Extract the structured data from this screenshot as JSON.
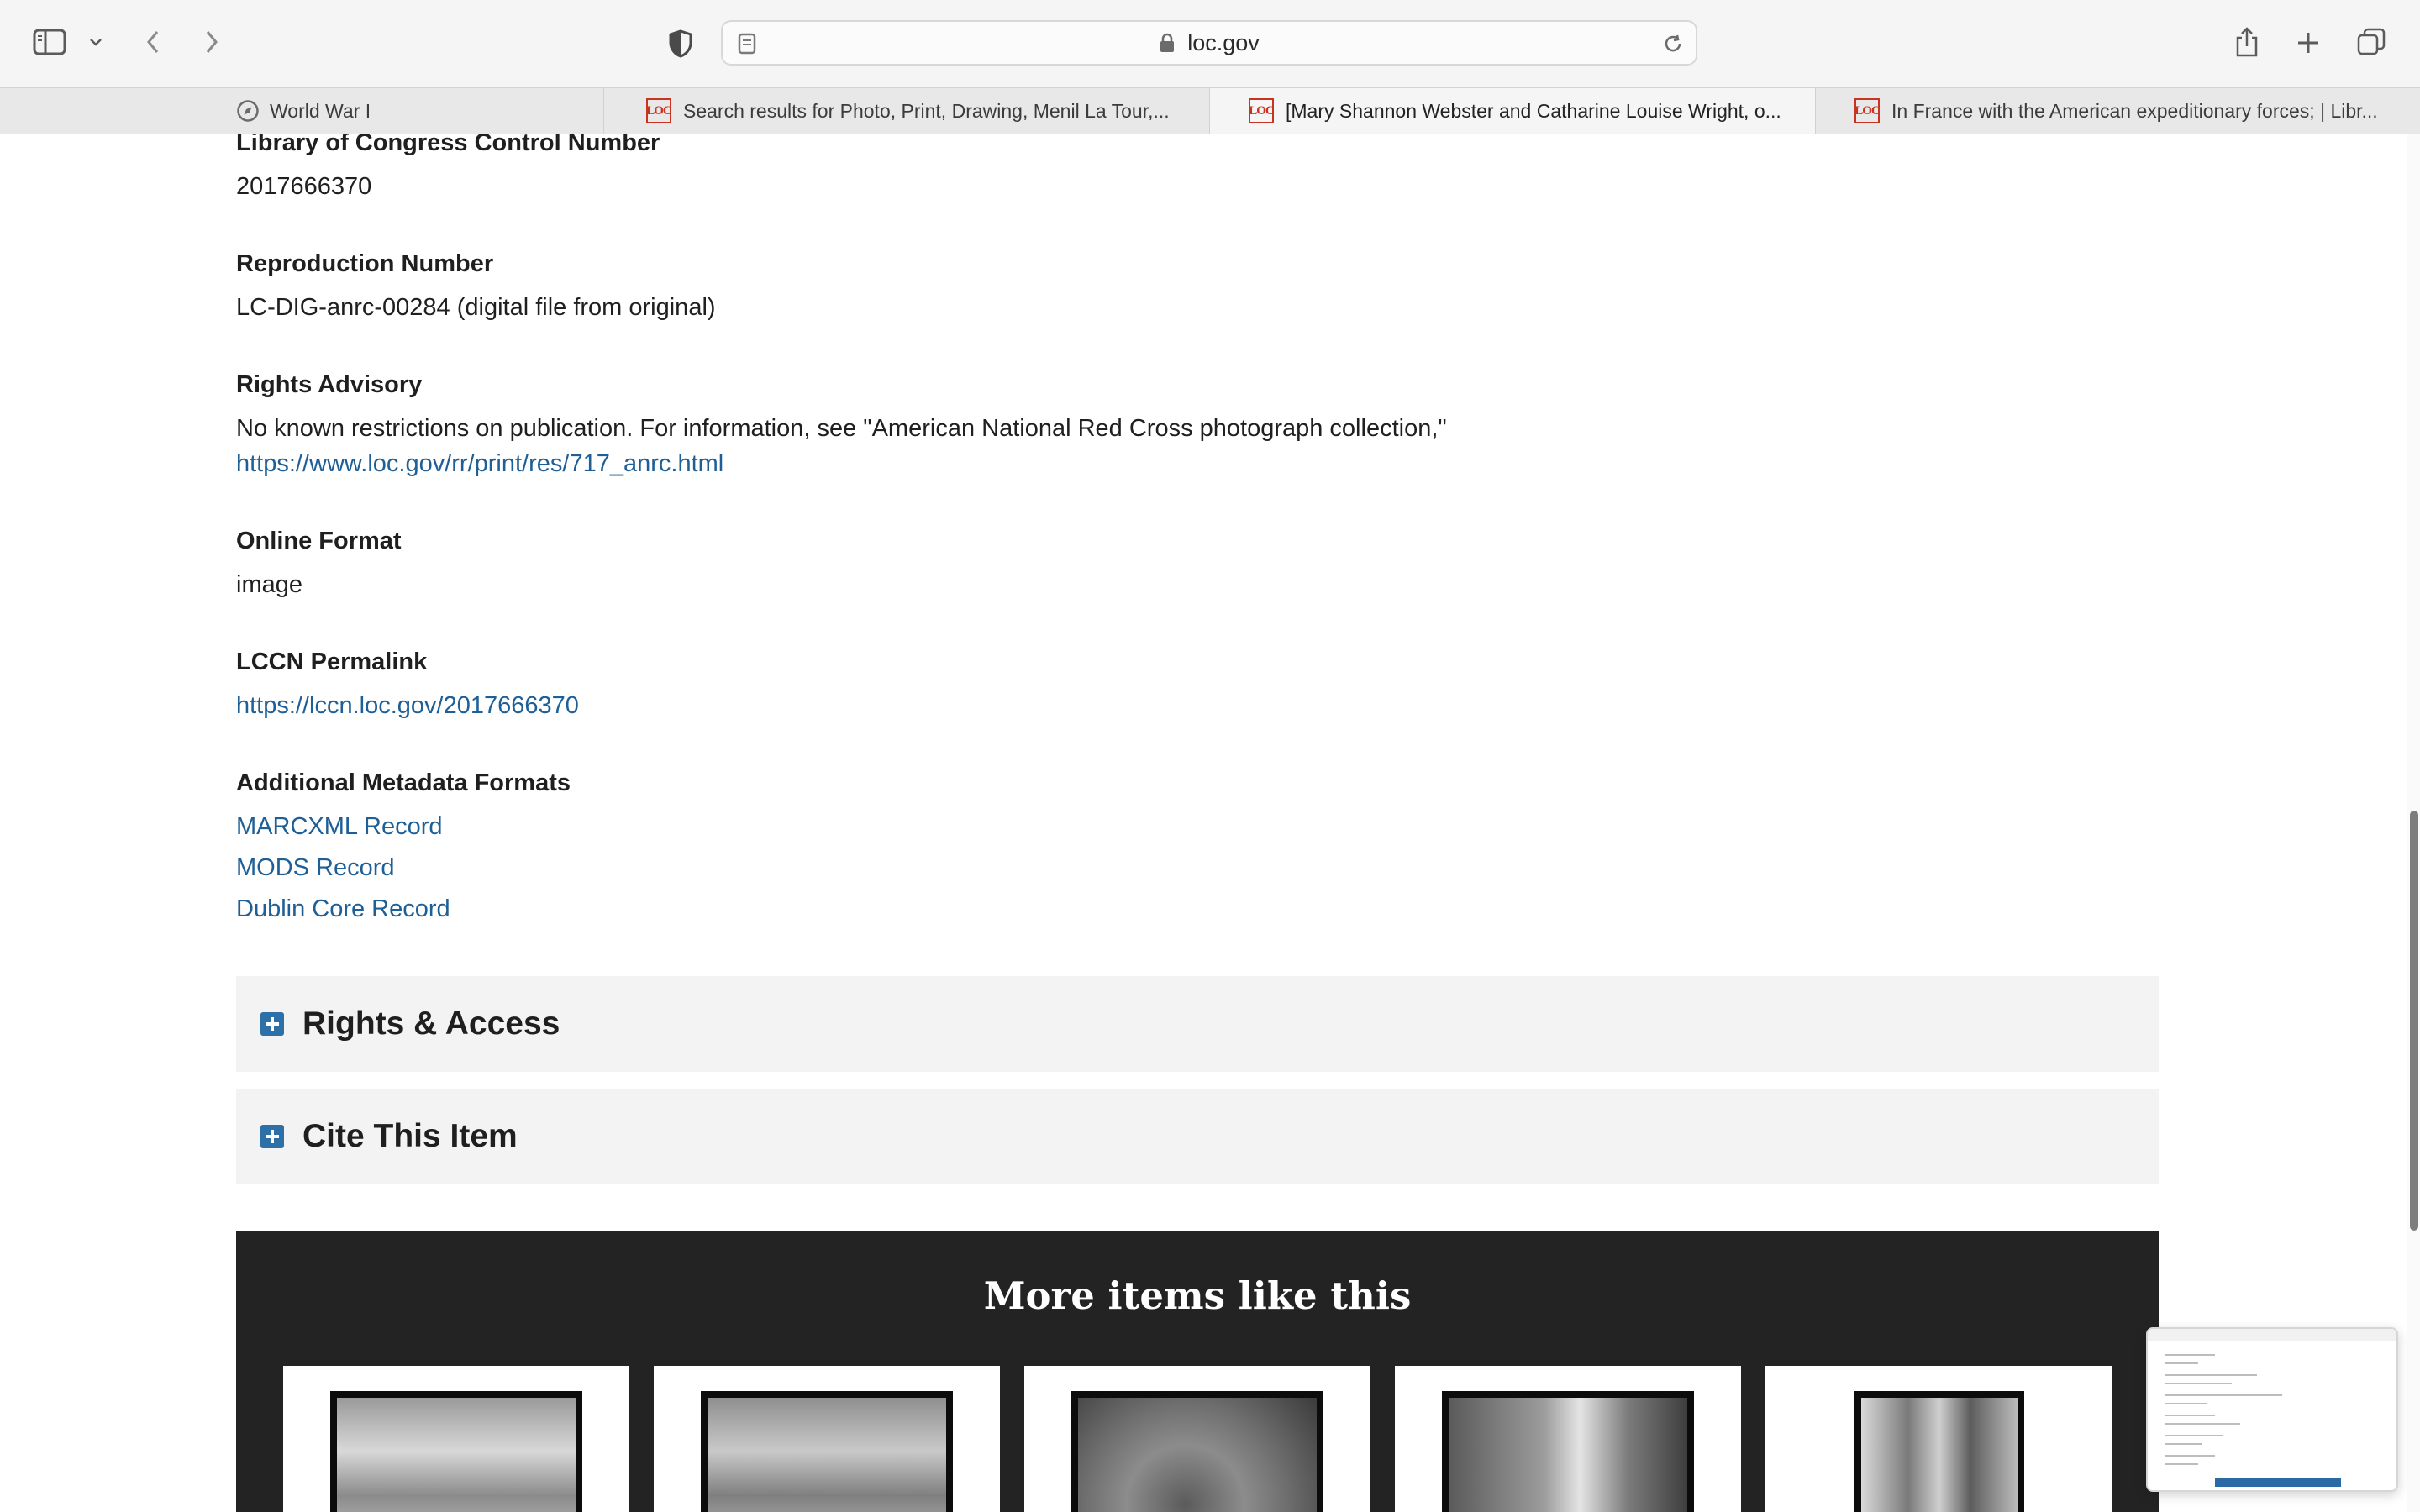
{
  "browser": {
    "url": "loc.gov",
    "tabs": [
      {
        "title": "World War I",
        "favicon": "compass-icon",
        "active": false
      },
      {
        "title": "Search results for Photo, Print, Drawing, Menil La Tour,...",
        "favicon": "loc-favicon",
        "active": false
      },
      {
        "title": "[Mary Shannon Webster and Catharine Louise Wright, o...",
        "favicon": "loc-favicon",
        "active": true
      },
      {
        "title": "In France with the American expeditionary forces; | Libr...",
        "favicon": "loc-favicon",
        "active": false
      }
    ],
    "favicon_text": "LOC"
  },
  "record": {
    "lccn_label": "Library of Congress Control Number",
    "lccn_value": "2017666370",
    "repro_label": "Reproduction Number",
    "repro_value": "LC-DIG-anrc-00284 (digital file from original)",
    "rights_label": "Rights Advisory",
    "rights_text": "No known restrictions on publication. For information, see \"American National Red Cross photograph collection,\"",
    "rights_link": "https://www.loc.gov/rr/print/res/717_anrc.html",
    "format_label": "Online Format",
    "format_value": "image",
    "permalink_label": "LCCN Permalink",
    "permalink_value": "https://lccn.loc.gov/2017666370",
    "metadata_label": "Additional Metadata Formats",
    "metadata_links": [
      "MARCXML Record",
      "MODS Record",
      "Dublin Core Record"
    ]
  },
  "accordions": [
    {
      "title": "Rights & Access"
    },
    {
      "title": "Cite This Item"
    }
  ],
  "more_items": {
    "title": "More items like this",
    "count": 5
  },
  "colors": {
    "link": "#1d5f96",
    "accordion_icon": "#2d6fa7",
    "more_bg": "#232323",
    "loc_red": "#c8341f"
  }
}
